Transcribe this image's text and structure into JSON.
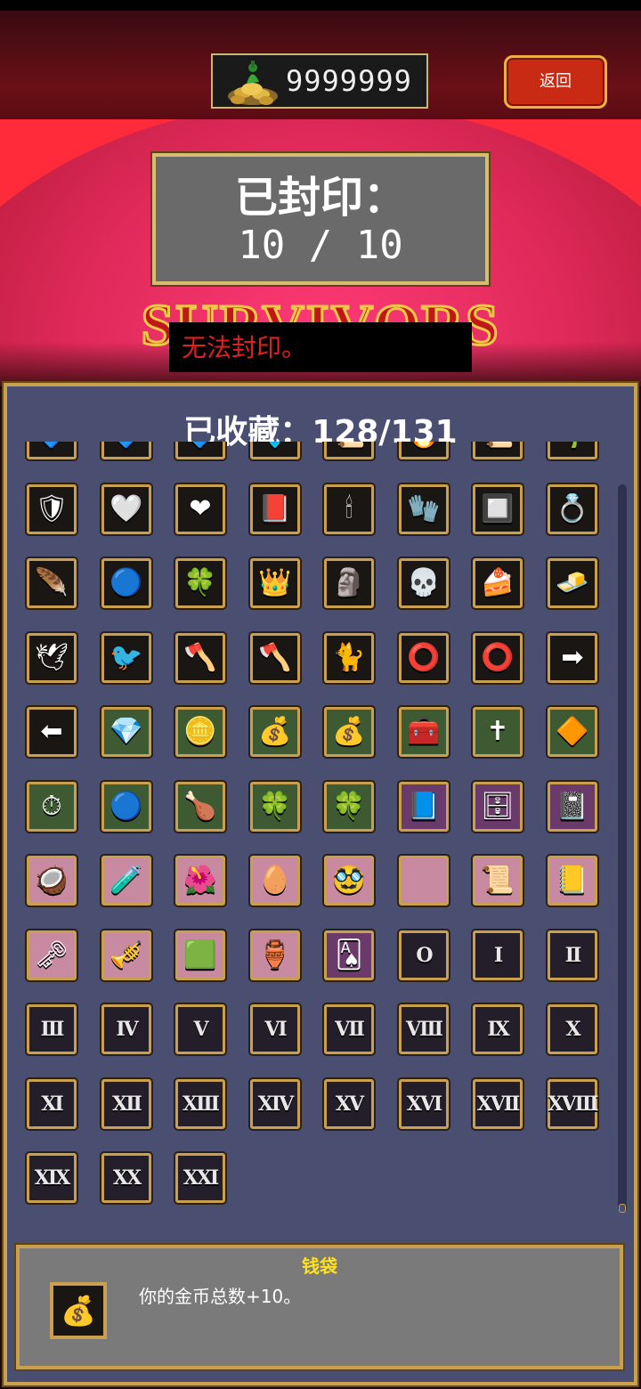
{
  "header": {
    "coin_icon": "coin-pile-icon",
    "coins": "9999999",
    "back_label": "返回"
  },
  "seal": {
    "title": "已封印：",
    "count": "10 / 10"
  },
  "logo_text": "SURVIVORS",
  "warning": "无法封印。",
  "collection": {
    "title": "已收藏：128/131",
    "items": [
      {
        "icon": "gem-icon",
        "glyph": "🔷",
        "bg": "d"
      },
      {
        "icon": "gem-icon",
        "glyph": "🔷",
        "bg": "d"
      },
      {
        "icon": "gem-icon",
        "glyph": "🔷",
        "bg": "d"
      },
      {
        "icon": "crystal-icon",
        "glyph": "💠",
        "bg": "d"
      },
      {
        "icon": "scroll-icon",
        "glyph": "📜",
        "bg": "d"
      },
      {
        "icon": "flame-icon",
        "glyph": "🔥",
        "bg": "d"
      },
      {
        "icon": "scroll-icon",
        "glyph": "📜",
        "bg": "d"
      },
      {
        "icon": "plant-icon",
        "glyph": "🌱",
        "bg": "d"
      },
      {
        "icon": "armor-icon",
        "glyph": "🛡",
        "bg": "d"
      },
      {
        "icon": "hollow-heart-icon",
        "glyph": "🤍",
        "bg": "d"
      },
      {
        "icon": "heart-icon",
        "glyph": "❤",
        "bg": "d"
      },
      {
        "icon": "red-book-icon",
        "glyph": "📕",
        "bg": "d"
      },
      {
        "icon": "candelabra-icon",
        "glyph": "🕯",
        "bg": "d"
      },
      {
        "icon": "gauntlet-icon",
        "glyph": "🧤",
        "bg": "d"
      },
      {
        "icon": "cage-icon",
        "glyph": "🔲",
        "bg": "d"
      },
      {
        "icon": "ring-icon",
        "glyph": "💍",
        "bg": "d"
      },
      {
        "icon": "wing-icon",
        "glyph": "🪶",
        "bg": "d"
      },
      {
        "icon": "orb-icon",
        "glyph": "🔵",
        "bg": "d"
      },
      {
        "icon": "clover-icon",
        "glyph": "🍀",
        "bg": "d"
      },
      {
        "icon": "crown-icon",
        "glyph": "👑",
        "bg": "d"
      },
      {
        "icon": "mask-icon",
        "glyph": "🗿",
        "bg": "d"
      },
      {
        "icon": "skull-icon",
        "glyph": "💀",
        "bg": "d"
      },
      {
        "icon": "tiramisu-icon",
        "glyph": "🍰",
        "bg": "d"
      },
      {
        "icon": "gold-bar-icon",
        "glyph": "🧈",
        "bg": "d"
      },
      {
        "icon": "dove-icon",
        "glyph": "🕊",
        "bg": "d"
      },
      {
        "icon": "red-bird-icon",
        "glyph": "🐦",
        "bg": "d"
      },
      {
        "icon": "red-wand-icon",
        "glyph": "🪓",
        "bg": "d"
      },
      {
        "icon": "blue-wand-icon",
        "glyph": "🪓",
        "bg": "d"
      },
      {
        "icon": "cat-icon",
        "glyph": "🐈",
        "bg": "d"
      },
      {
        "icon": "dark-ring-icon",
        "glyph": "⭕",
        "bg": "d"
      },
      {
        "icon": "green-ring-icon",
        "glyph": "⭕",
        "bg": "d"
      },
      {
        "icon": "red-arrow-right-icon",
        "glyph": "➡",
        "bg": "d"
      },
      {
        "icon": "red-arrow-left-icon",
        "glyph": "⬅",
        "bg": "d"
      },
      {
        "icon": "blue-crystal-icon",
        "glyph": "💎",
        "bg": "g"
      },
      {
        "icon": "gold-coin-icon",
        "glyph": "🪙",
        "bg": "g"
      },
      {
        "icon": "money-bag-icon",
        "glyph": "💰",
        "bg": "g"
      },
      {
        "icon": "big-money-bag-icon",
        "glyph": "💰",
        "bg": "g"
      },
      {
        "icon": "chest-icon",
        "glyph": "🧰",
        "bg": "g"
      },
      {
        "icon": "rosary-icon",
        "glyph": "✝",
        "bg": "g"
      },
      {
        "icon": "orange-gem-icon",
        "glyph": "🔶",
        "bg": "g"
      },
      {
        "icon": "stopwatch-icon",
        "glyph": "⏱",
        "bg": "g"
      },
      {
        "icon": "blue-orb-icon",
        "glyph": "🔵",
        "bg": "g"
      },
      {
        "icon": "roast-chicken-icon",
        "glyph": "🍗",
        "bg": "g"
      },
      {
        "icon": "yellow-clover-icon",
        "glyph": "🍀",
        "bg": "g"
      },
      {
        "icon": "green-clover-icon",
        "glyph": "🍀",
        "bg": "g"
      },
      {
        "icon": "purple-book-icon",
        "glyph": "📘",
        "bg": "v"
      },
      {
        "icon": "cabinet-icon",
        "glyph": "🗄",
        "bg": "v"
      },
      {
        "icon": "dark-book-icon",
        "glyph": "📓",
        "bg": "v"
      },
      {
        "icon": "brown-orb-icon",
        "glyph": "🥥",
        "bg": "p"
      },
      {
        "icon": "potion-icon",
        "glyph": "🧪",
        "bg": "p"
      },
      {
        "icon": "flower-icon",
        "glyph": "🌺",
        "bg": "p"
      },
      {
        "icon": "egg-icon",
        "glyph": "🥚",
        "bg": "p"
      },
      {
        "icon": "disguise-glasses-icon",
        "glyph": "🥸",
        "bg": "p"
      },
      {
        "icon": "empty-slot-icon",
        "glyph": "",
        "bg": "p"
      },
      {
        "icon": "scroll-icon",
        "glyph": "📜",
        "bg": "p"
      },
      {
        "icon": "gold-book-icon",
        "glyph": "📒",
        "bg": "p"
      },
      {
        "icon": "green-key-icon",
        "glyph": "🗝",
        "bg": "p"
      },
      {
        "icon": "trumpet-icon",
        "glyph": "🎺",
        "bg": "p"
      },
      {
        "icon": "green-cube-icon",
        "glyph": "🟩",
        "bg": "p"
      },
      {
        "icon": "red-potion-icon",
        "glyph": "🏺",
        "bg": "p"
      },
      {
        "icon": "card-icon",
        "glyph": "🂡",
        "bg": "v"
      },
      {
        "icon": "roman-numeral-0-icon",
        "glyph": "O",
        "bg": "r"
      },
      {
        "icon": "roman-numeral-1-icon",
        "glyph": "I",
        "bg": "r"
      },
      {
        "icon": "roman-numeral-2-icon",
        "glyph": "II",
        "bg": "r"
      },
      {
        "icon": "roman-numeral-3-icon",
        "glyph": "III",
        "bg": "r"
      },
      {
        "icon": "roman-numeral-4-icon",
        "glyph": "IV",
        "bg": "r"
      },
      {
        "icon": "roman-numeral-5-icon",
        "glyph": "V",
        "bg": "r"
      },
      {
        "icon": "roman-numeral-6-icon",
        "glyph": "VI",
        "bg": "r"
      },
      {
        "icon": "roman-numeral-7-icon",
        "glyph": "VII",
        "bg": "r"
      },
      {
        "icon": "roman-numeral-8-icon",
        "glyph": "VIII",
        "bg": "r"
      },
      {
        "icon": "roman-numeral-9-icon",
        "glyph": "IX",
        "bg": "r"
      },
      {
        "icon": "roman-numeral-10-icon",
        "glyph": "X",
        "bg": "r"
      },
      {
        "icon": "roman-numeral-11-icon",
        "glyph": "XI",
        "bg": "r"
      },
      {
        "icon": "roman-numeral-12-icon",
        "glyph": "XII",
        "bg": "r"
      },
      {
        "icon": "roman-numeral-13-icon",
        "glyph": "XIII",
        "bg": "r"
      },
      {
        "icon": "roman-numeral-14-icon",
        "glyph": "XIV",
        "bg": "r"
      },
      {
        "icon": "roman-numeral-15-icon",
        "glyph": "XV",
        "bg": "r"
      },
      {
        "icon": "roman-numeral-16-icon",
        "glyph": "XVI",
        "bg": "r"
      },
      {
        "icon": "roman-numeral-17-icon",
        "glyph": "XVII",
        "bg": "r"
      },
      {
        "icon": "roman-numeral-18-icon",
        "glyph": "XVIII",
        "bg": "r"
      },
      {
        "icon": "roman-numeral-19-icon",
        "glyph": "XIX",
        "bg": "r"
      },
      {
        "icon": "roman-numeral-20-icon",
        "glyph": "XX",
        "bg": "r"
      },
      {
        "icon": "roman-numeral-21-icon",
        "glyph": "XXI",
        "bg": "r"
      }
    ]
  },
  "info": {
    "item_name": "钱袋",
    "item_icon": "money-bag-icon",
    "item_glyph": "💰",
    "description": "你的金币总数+10。"
  },
  "colors": {
    "panel": "#4a4e70",
    "gold_border": "#c8a050",
    "accent_red": "#c82a14",
    "highlight_yellow": "#ffe020"
  }
}
